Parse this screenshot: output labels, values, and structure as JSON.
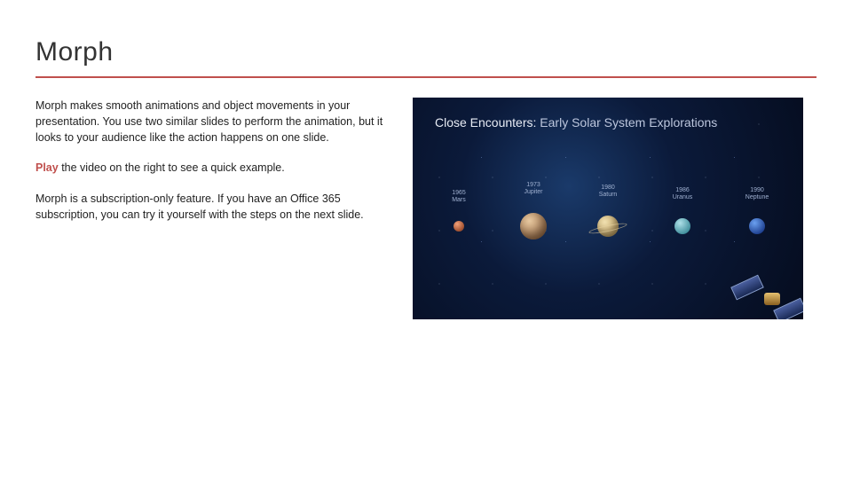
{
  "title": "Morph",
  "paragraphs": {
    "p1": "Morph makes smooth animations and object movements in your presentation. You use two similar slides to perform the animation, but it looks to your audience like the action happens on one slide.",
    "play_word": "Play",
    "p2_rest": " the video on the right to see a quick example.",
    "p3": "Morph is a subscription-only feature. If you have an Office 365 subscription, you can try it yourself with the steps on the next slide."
  },
  "media": {
    "title_main": "Close Encounters: ",
    "title_sub": "Early Solar System Explorations",
    "planets": [
      {
        "year": "1965",
        "name": "Mars",
        "cls": "mars"
      },
      {
        "year": "1973",
        "name": "Jupiter",
        "cls": "jupiter"
      },
      {
        "year": "1980",
        "name": "Saturn",
        "cls": "saturn"
      },
      {
        "year": "1986",
        "name": "Uranus",
        "cls": "uranus"
      },
      {
        "year": "1990",
        "name": "Neptune",
        "cls": "neptune"
      }
    ]
  }
}
